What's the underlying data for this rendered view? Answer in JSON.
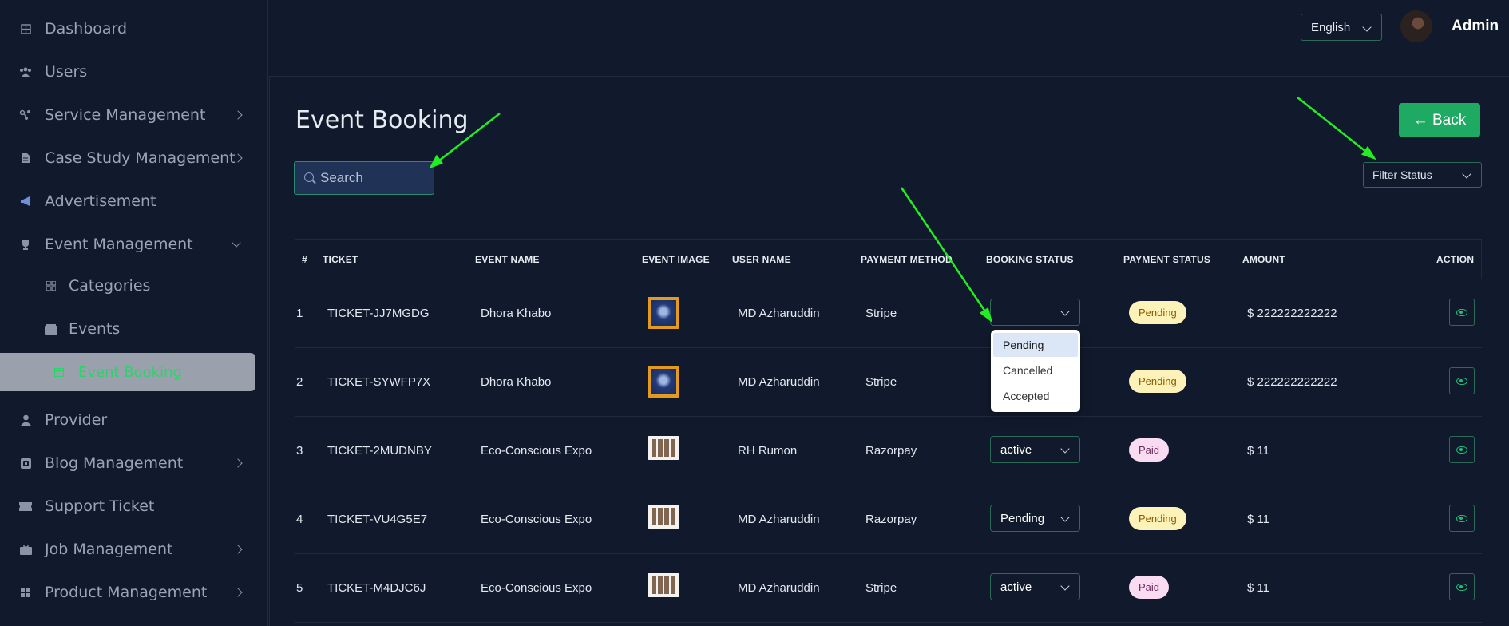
{
  "sidebar": {
    "items": [
      {
        "label": "Dashboard",
        "icon": "dashboard-icon"
      },
      {
        "label": "Users",
        "icon": "users-icon"
      },
      {
        "label": "Service Management",
        "icon": "services-icon"
      },
      {
        "label": "Case Study Management",
        "icon": "document-icon"
      },
      {
        "label": "Advertisement",
        "icon": "megaphone-icon"
      },
      {
        "label": "Event Management",
        "icon": "trophy-icon"
      },
      {
        "label": "Categories",
        "icon": "grid-icon"
      },
      {
        "label": "Events",
        "icon": "wallet-icon"
      },
      {
        "label": "Event Booking",
        "icon": "calendar-icon"
      },
      {
        "label": "Provider",
        "icon": "user-icon"
      },
      {
        "label": "Blog Management",
        "icon": "blog-icon"
      },
      {
        "label": "Support Ticket",
        "icon": "ticket-icon"
      },
      {
        "label": "Job Management",
        "icon": "briefcase-icon"
      },
      {
        "label": "Product Management",
        "icon": "grid-icon"
      }
    ]
  },
  "topbar": {
    "language": "English",
    "user_name": "Admin"
  },
  "page": {
    "title": "Event Booking",
    "back_label": "← Back",
    "search_placeholder": "Search",
    "filter_label": "Filter Status"
  },
  "table": {
    "headers": [
      "#",
      "TICKET",
      "EVENT NAME",
      "EVENT IMAGE",
      "USER NAME",
      "PAYMENT METHOD",
      "BOOKING STATUS",
      "PAYMENT STATUS",
      "AMOUNT",
      "ACTION"
    ],
    "rows": [
      {
        "num": "1",
        "ticket": "TICKET-JJ7MGDG",
        "event": "Dhora Khabo",
        "user": "MD Azharuddin",
        "method": "Stripe",
        "booking": "",
        "payment": "Pending",
        "amount": "$ 222222222222"
      },
      {
        "num": "2",
        "ticket": "TICKET-SYWFP7X",
        "event": "Dhora Khabo",
        "user": "MD Azharuddin",
        "method": "Stripe",
        "booking": "",
        "payment": "Pending",
        "amount": "$ 222222222222"
      },
      {
        "num": "3",
        "ticket": "TICKET-2MUDNBY",
        "event": "Eco-Conscious Expo",
        "user": "RH Rumon",
        "method": "Razorpay",
        "booking": "active",
        "payment": "Paid",
        "amount": "$ 11"
      },
      {
        "num": "4",
        "ticket": "TICKET-VU4G5E7",
        "event": "Eco-Conscious Expo",
        "user": "MD Azharuddin",
        "method": "Razorpay",
        "booking": "Pending",
        "payment": "Pending",
        "amount": "$ 11"
      },
      {
        "num": "5",
        "ticket": "TICKET-M4DJC6J",
        "event": "Eco-Conscious Expo",
        "user": "MD Azharuddin",
        "method": "Stripe",
        "booking": "active",
        "payment": "Paid",
        "amount": "$ 11"
      }
    ]
  },
  "dropdown": {
    "options": [
      "Pending",
      "Cancelled",
      "Accepted"
    ]
  },
  "colors": {
    "background": "#111a2c",
    "accent": "#1faa63",
    "active_nav_text": "#2bd46a",
    "annotation_arrow": "#22ee22"
  }
}
